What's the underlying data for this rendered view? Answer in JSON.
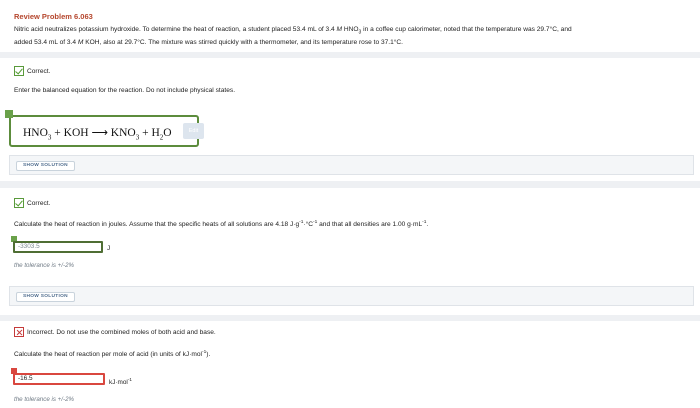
{
  "problem": {
    "title": "Review Problem 6.063",
    "statement_line1_a": "Nitric acid neutralizes potassium hydroxide. To determine the heat of reaction, a student placed 53.4 mL of 3.4 ",
    "statement_line1_m": "M",
    "statement_line1_b": " HNO",
    "statement_line1_sub": "3",
    "statement_line1_c": " in a coffee cup calorimeter, noted that the temperature was 29.7°C, and",
    "statement_line2_a": "added 53.4 mL of 3.4 ",
    "statement_line2_m": "M",
    "statement_line2_b": " KOH, also at 29.7°C. The mixture was stirred quickly with a thermometer, and its temperature rose to 37.1°C."
  },
  "part1": {
    "status": "Correct.",
    "prompt": "Enter the balanced equation for the reaction. Do not include physical states.",
    "eq_hno": "HNO",
    "eq_3a": "3",
    "eq_mid": " + KOH ⟶ KNO",
    "eq_3b": "3",
    "eq_h": " + H",
    "eq_2": "2",
    "eq_o": "O",
    "edit_label": "Edit",
    "solution_label": "SHOW SOLUTION"
  },
  "part2": {
    "status": "Correct.",
    "prompt_a": "Calculate the heat of reaction in joules. Assume that the specific heats of all solutions are 4.18 J·g",
    "prompt_sup1": "-1",
    "prompt_b": "·°C",
    "prompt_sup2": "-1",
    "prompt_c": " and that all densities are 1.00 g·mL",
    "prompt_sup3": "-1",
    "prompt_d": ".",
    "answer": "-3303.5",
    "unit": "J",
    "tolerance": "the tolerance is +/-2%",
    "solution_label": "SHOW SOLUTION"
  },
  "part3": {
    "status": "Incorrect.  Do not use the combined moles of both acid and base.",
    "prompt_a": "Calculate the heat of reaction per mole of acid (in units of kJ·mol",
    "prompt_sup": "-1",
    "prompt_b": ").",
    "answer": "-16.5",
    "unit": "kJ·mol",
    "unit_sup": "-1",
    "tolerance": "the tolerance is +/-2%"
  }
}
